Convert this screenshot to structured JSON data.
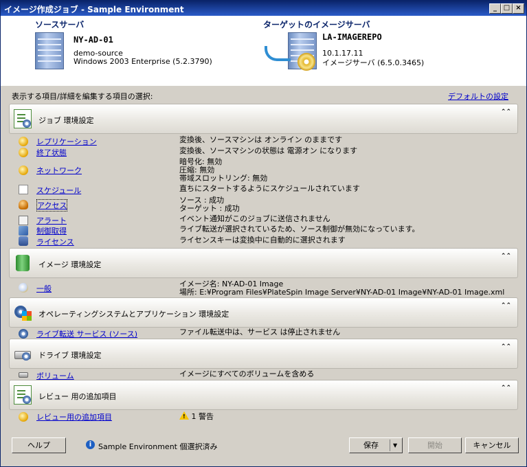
{
  "window": {
    "title": "イメージ作成ジョブ - Sample Environment",
    "min": "_",
    "max": "□",
    "close": "×"
  },
  "source": {
    "heading": "ソースサーバ",
    "name": "NY-AD-01",
    "line1": "demo-source",
    "line2": "Windows 2003 Enterprise (5.2.3790)"
  },
  "target": {
    "heading": "ターゲットのイメージサーバ",
    "name": "LA-IMAGEREPO",
    "line1": "10.1.17.11",
    "line2": "イメージサーバ (6.5.0.3465)"
  },
  "select_title": "表示する項目/詳細を編集する項目の選択:",
  "default_link": "デフォルトの設定",
  "collapse_glyph": "⌃⌃",
  "sections": {
    "job": {
      "title": "ジョブ 環境設定",
      "rows": [
        {
          "label": "レプリケーション",
          "value": "変換後、ソースマシンは オンライン のままです"
        },
        {
          "label": "終了状態",
          "value": "変換後、ソースマシンの状態は 電源オン になります"
        },
        {
          "label": "ネットワーク",
          "value_lines": [
            "暗号化: 無効",
            "圧縮: 無効",
            "帯域スロットリング: 無効"
          ]
        },
        {
          "label": "スケジュール",
          "value": "直ちにスタートするようにスケジュールされています"
        },
        {
          "label": "アクセス",
          "value_lines": [
            "ソース : 成功",
            "ターゲット : 成功"
          ]
        },
        {
          "label": "アラート",
          "value": "イベント通知がこのジョブに送信されません"
        },
        {
          "label": "制御取得",
          "value": "ライブ転送が選択されているため、ソース制御が無効になっています。"
        },
        {
          "label": "ライセンス",
          "value": "ライセンスキーは変換中に自動的に選択されます"
        }
      ]
    },
    "image": {
      "title": "イメージ 環境設定",
      "rows": [
        {
          "label": "一般",
          "value_lines": [
            "イメージ名: NY-AD-01 Image",
            "場所: E:¥Program Files¥PlateSpin Image Server¥NY-AD-01 Image¥NY-AD-01 Image.xml"
          ]
        }
      ]
    },
    "os": {
      "title": "オペレーティングシステムとアプリケーション 環境設定",
      "rows": [
        {
          "label": "ライブ転送 サービス (ソース)",
          "value": "ファイル転送中は、サービス は停止されません"
        }
      ]
    },
    "drive": {
      "title": "ドライブ 環境設定",
      "rows": [
        {
          "label": "ボリューム",
          "value": "イメージにすべてのボリュームを含める"
        }
      ]
    },
    "review": {
      "title": "レビュー 用の追加項目",
      "rows": [
        {
          "label": "レビュー用の追加項目",
          "value": "1 警告"
        }
      ]
    }
  },
  "footer": {
    "help": "ヘルプ",
    "status": "Sample Environment 個選択済み",
    "save": "保存",
    "save_dropdown": "▼",
    "start": "開始",
    "cancel": "キャンセル"
  }
}
